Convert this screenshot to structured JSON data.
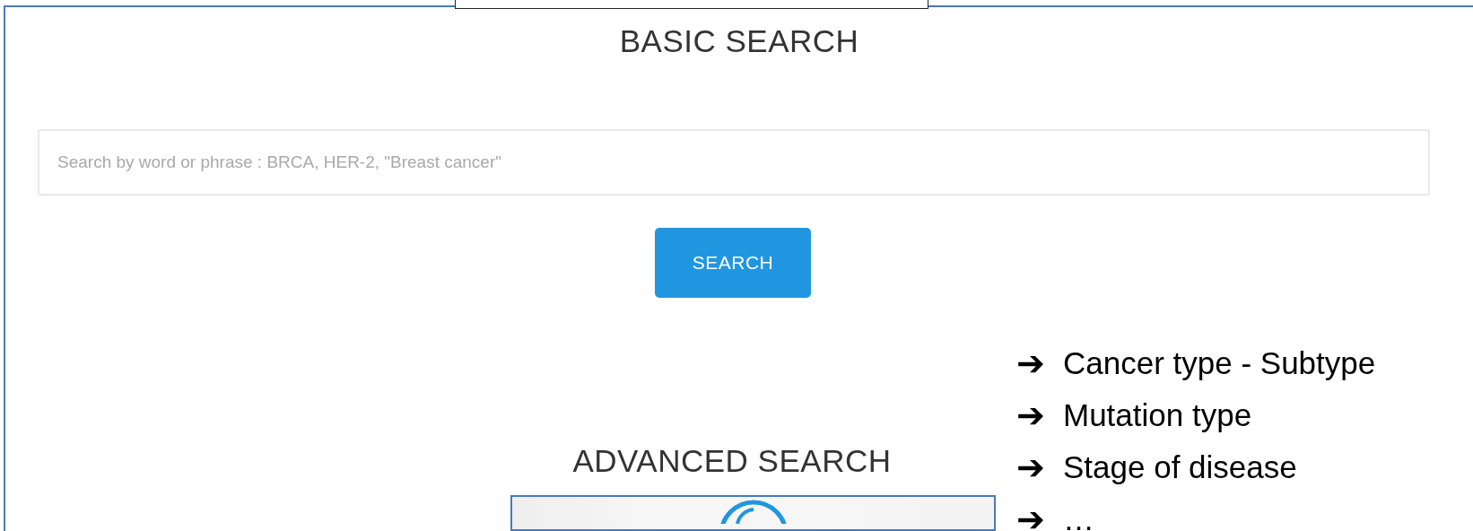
{
  "basic_search": {
    "heading": "BASIC SEARCH",
    "search_field": {
      "placeholder": "Search by word or phrase : BRCA, HER-2, \"Breast cancer\""
    },
    "button": "SEARCH"
  },
  "advanced_search": {
    "heading": "ADVANCED SEARCH"
  },
  "annotation_list": [
    {
      "arrow": "➔",
      "text": "Cancer type - Subtype"
    },
    {
      "arrow": "➔",
      "text": "Mutation type"
    },
    {
      "arrow": "➔",
      "text": "Stage of disease"
    },
    {
      "arrow": "➔",
      "text": "…"
    }
  ]
}
